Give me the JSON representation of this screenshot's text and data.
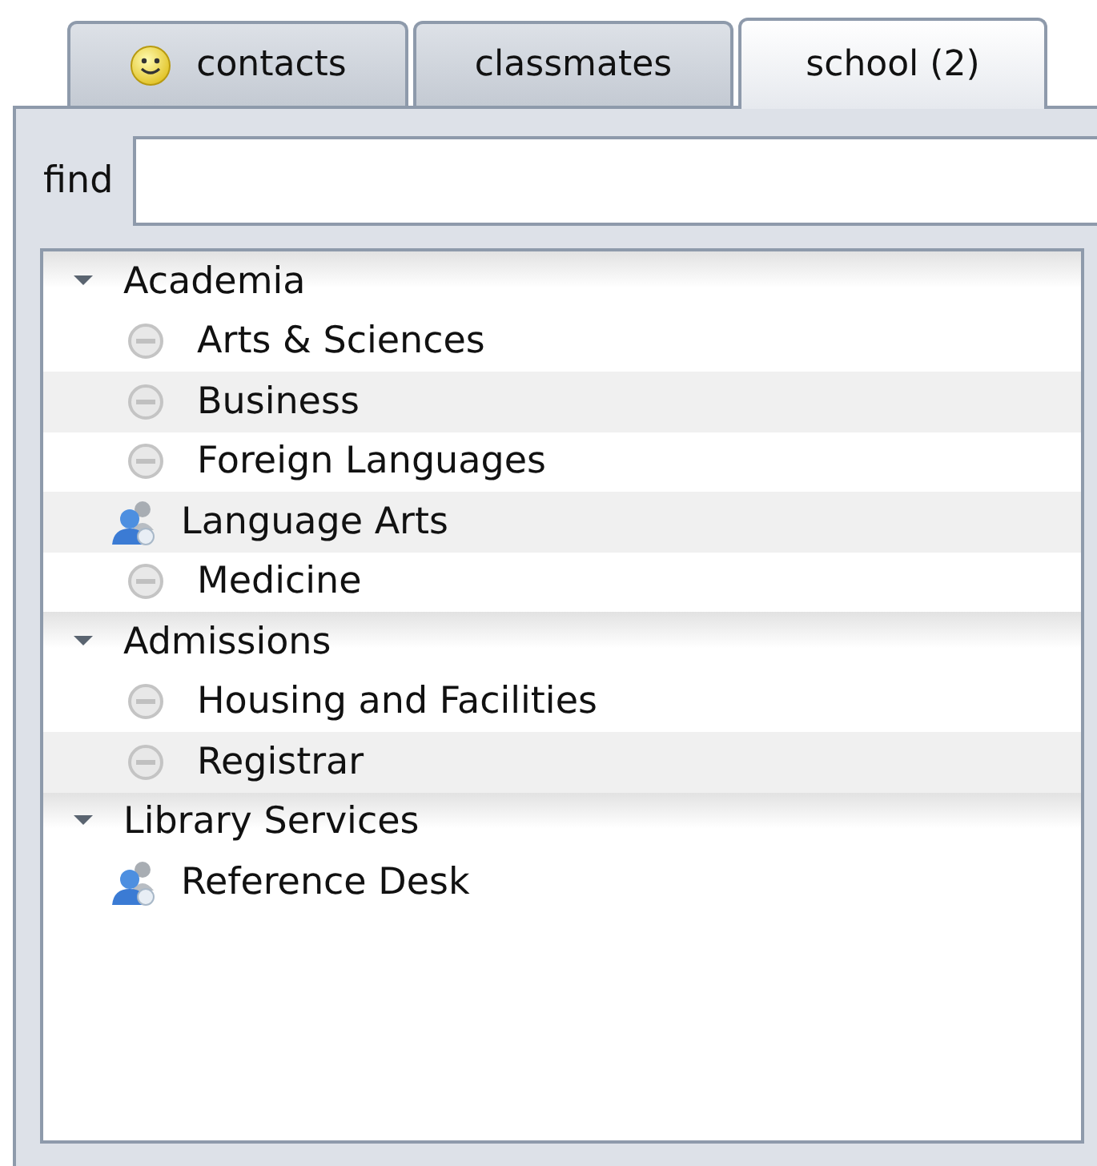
{
  "tabs": [
    {
      "label": "contacts",
      "selected": false,
      "icon": true
    },
    {
      "label": "classmates",
      "selected": false,
      "icon": false
    },
    {
      "label": "school (2)",
      "selected": true,
      "icon": false
    }
  ],
  "search": {
    "label": "find"
  },
  "groups": [
    {
      "name": "Academia",
      "expanded": true,
      "children": [
        {
          "name": "Arts & Sciences",
          "online": false
        },
        {
          "name": "Business",
          "online": false
        },
        {
          "name": "Foreign Languages",
          "online": false
        },
        {
          "name": "Language Arts",
          "online": true
        },
        {
          "name": "Medicine",
          "online": false
        }
      ]
    },
    {
      "name": "Admissions",
      "expanded": true,
      "children": [
        {
          "name": "Housing and Facilities",
          "online": false
        },
        {
          "name": "Registrar",
          "online": false
        }
      ]
    },
    {
      "name": "Library Services",
      "expanded": true,
      "children": [
        {
          "name": "Reference Desk",
          "online": true
        }
      ]
    }
  ]
}
